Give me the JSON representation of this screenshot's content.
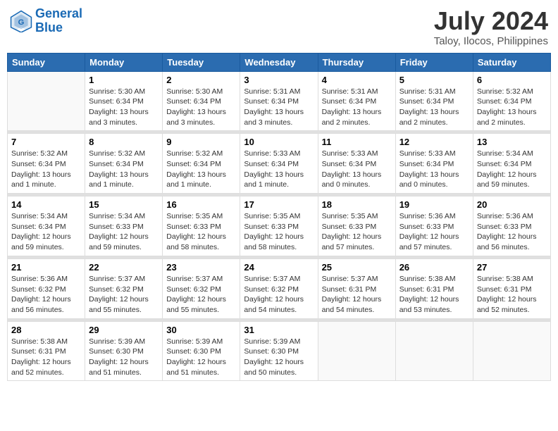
{
  "header": {
    "logo_line1": "General",
    "logo_line2": "Blue",
    "month_year": "July 2024",
    "location": "Taloy, Ilocos, Philippines"
  },
  "days_of_week": [
    "Sunday",
    "Monday",
    "Tuesday",
    "Wednesday",
    "Thursday",
    "Friday",
    "Saturday"
  ],
  "weeks": [
    [
      {
        "day": "",
        "sunrise": "",
        "sunset": "",
        "daylight": ""
      },
      {
        "day": "1",
        "sunrise": "Sunrise: 5:30 AM",
        "sunset": "Sunset: 6:34 PM",
        "daylight": "Daylight: 13 hours and 3 minutes."
      },
      {
        "day": "2",
        "sunrise": "Sunrise: 5:30 AM",
        "sunset": "Sunset: 6:34 PM",
        "daylight": "Daylight: 13 hours and 3 minutes."
      },
      {
        "day": "3",
        "sunrise": "Sunrise: 5:31 AM",
        "sunset": "Sunset: 6:34 PM",
        "daylight": "Daylight: 13 hours and 3 minutes."
      },
      {
        "day": "4",
        "sunrise": "Sunrise: 5:31 AM",
        "sunset": "Sunset: 6:34 PM",
        "daylight": "Daylight: 13 hours and 2 minutes."
      },
      {
        "day": "5",
        "sunrise": "Sunrise: 5:31 AM",
        "sunset": "Sunset: 6:34 PM",
        "daylight": "Daylight: 13 hours and 2 minutes."
      },
      {
        "day": "6",
        "sunrise": "Sunrise: 5:32 AM",
        "sunset": "Sunset: 6:34 PM",
        "daylight": "Daylight: 13 hours and 2 minutes."
      }
    ],
    [
      {
        "day": "7",
        "sunrise": "Sunrise: 5:32 AM",
        "sunset": "Sunset: 6:34 PM",
        "daylight": "Daylight: 13 hours and 1 minute."
      },
      {
        "day": "8",
        "sunrise": "Sunrise: 5:32 AM",
        "sunset": "Sunset: 6:34 PM",
        "daylight": "Daylight: 13 hours and 1 minute."
      },
      {
        "day": "9",
        "sunrise": "Sunrise: 5:32 AM",
        "sunset": "Sunset: 6:34 PM",
        "daylight": "Daylight: 13 hours and 1 minute."
      },
      {
        "day": "10",
        "sunrise": "Sunrise: 5:33 AM",
        "sunset": "Sunset: 6:34 PM",
        "daylight": "Daylight: 13 hours and 1 minute."
      },
      {
        "day": "11",
        "sunrise": "Sunrise: 5:33 AM",
        "sunset": "Sunset: 6:34 PM",
        "daylight": "Daylight: 13 hours and 0 minutes."
      },
      {
        "day": "12",
        "sunrise": "Sunrise: 5:33 AM",
        "sunset": "Sunset: 6:34 PM",
        "daylight": "Daylight: 13 hours and 0 minutes."
      },
      {
        "day": "13",
        "sunrise": "Sunrise: 5:34 AM",
        "sunset": "Sunset: 6:34 PM",
        "daylight": "Daylight: 12 hours and 59 minutes."
      }
    ],
    [
      {
        "day": "14",
        "sunrise": "Sunrise: 5:34 AM",
        "sunset": "Sunset: 6:34 PM",
        "daylight": "Daylight: 12 hours and 59 minutes."
      },
      {
        "day": "15",
        "sunrise": "Sunrise: 5:34 AM",
        "sunset": "Sunset: 6:33 PM",
        "daylight": "Daylight: 12 hours and 59 minutes."
      },
      {
        "day": "16",
        "sunrise": "Sunrise: 5:35 AM",
        "sunset": "Sunset: 6:33 PM",
        "daylight": "Daylight: 12 hours and 58 minutes."
      },
      {
        "day": "17",
        "sunrise": "Sunrise: 5:35 AM",
        "sunset": "Sunset: 6:33 PM",
        "daylight": "Daylight: 12 hours and 58 minutes."
      },
      {
        "day": "18",
        "sunrise": "Sunrise: 5:35 AM",
        "sunset": "Sunset: 6:33 PM",
        "daylight": "Daylight: 12 hours and 57 minutes."
      },
      {
        "day": "19",
        "sunrise": "Sunrise: 5:36 AM",
        "sunset": "Sunset: 6:33 PM",
        "daylight": "Daylight: 12 hours and 57 minutes."
      },
      {
        "day": "20",
        "sunrise": "Sunrise: 5:36 AM",
        "sunset": "Sunset: 6:33 PM",
        "daylight": "Daylight: 12 hours and 56 minutes."
      }
    ],
    [
      {
        "day": "21",
        "sunrise": "Sunrise: 5:36 AM",
        "sunset": "Sunset: 6:32 PM",
        "daylight": "Daylight: 12 hours and 56 minutes."
      },
      {
        "day": "22",
        "sunrise": "Sunrise: 5:37 AM",
        "sunset": "Sunset: 6:32 PM",
        "daylight": "Daylight: 12 hours and 55 minutes."
      },
      {
        "day": "23",
        "sunrise": "Sunrise: 5:37 AM",
        "sunset": "Sunset: 6:32 PM",
        "daylight": "Daylight: 12 hours and 55 minutes."
      },
      {
        "day": "24",
        "sunrise": "Sunrise: 5:37 AM",
        "sunset": "Sunset: 6:32 PM",
        "daylight": "Daylight: 12 hours and 54 minutes."
      },
      {
        "day": "25",
        "sunrise": "Sunrise: 5:37 AM",
        "sunset": "Sunset: 6:31 PM",
        "daylight": "Daylight: 12 hours and 54 minutes."
      },
      {
        "day": "26",
        "sunrise": "Sunrise: 5:38 AM",
        "sunset": "Sunset: 6:31 PM",
        "daylight": "Daylight: 12 hours and 53 minutes."
      },
      {
        "day": "27",
        "sunrise": "Sunrise: 5:38 AM",
        "sunset": "Sunset: 6:31 PM",
        "daylight": "Daylight: 12 hours and 52 minutes."
      }
    ],
    [
      {
        "day": "28",
        "sunrise": "Sunrise: 5:38 AM",
        "sunset": "Sunset: 6:31 PM",
        "daylight": "Daylight: 12 hours and 52 minutes."
      },
      {
        "day": "29",
        "sunrise": "Sunrise: 5:39 AM",
        "sunset": "Sunset: 6:30 PM",
        "daylight": "Daylight: 12 hours and 51 minutes."
      },
      {
        "day": "30",
        "sunrise": "Sunrise: 5:39 AM",
        "sunset": "Sunset: 6:30 PM",
        "daylight": "Daylight: 12 hours and 51 minutes."
      },
      {
        "day": "31",
        "sunrise": "Sunrise: 5:39 AM",
        "sunset": "Sunset: 6:30 PM",
        "daylight": "Daylight: 12 hours and 50 minutes."
      },
      {
        "day": "",
        "sunrise": "",
        "sunset": "",
        "daylight": ""
      },
      {
        "day": "",
        "sunrise": "",
        "sunset": "",
        "daylight": ""
      },
      {
        "day": "",
        "sunrise": "",
        "sunset": "",
        "daylight": ""
      }
    ]
  ]
}
